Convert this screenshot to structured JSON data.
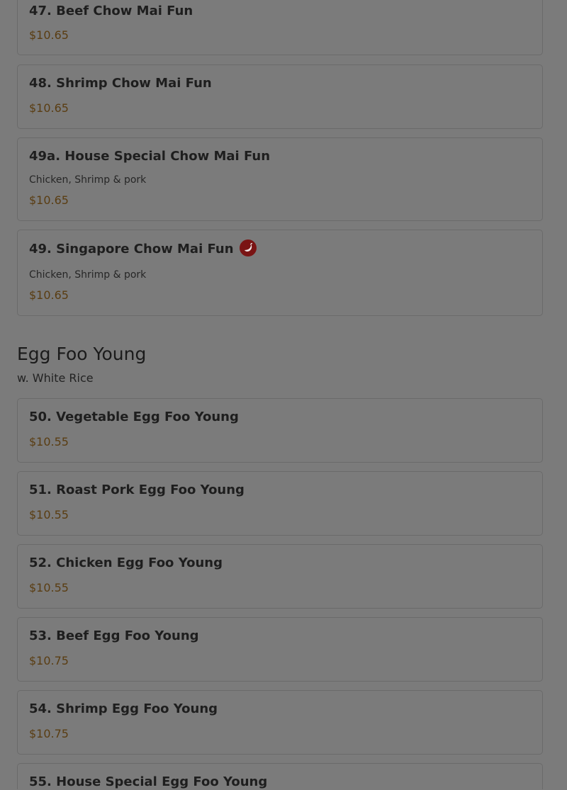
{
  "sections": [
    {
      "items": [
        {
          "name": "47. Beef Chow Mai Fun",
          "price": "$10.65"
        },
        {
          "name": "48. Shrimp Chow Mai Fun",
          "price": "$10.65"
        },
        {
          "name": "49a. House Special Chow Mai Fun",
          "description": "Chicken, Shrimp & pork",
          "price": "$10.65"
        },
        {
          "name": "49. Singapore Chow Mai Fun",
          "description": "Chicken, Shrimp & pork",
          "price": "$10.65",
          "icon": "spicy-pepper-icon"
        }
      ]
    },
    {
      "title": "Egg Foo Young",
      "subtitle": "w. White Rice",
      "items": [
        {
          "name": "50. Vegetable Egg Foo Young",
          "price": "$10.55"
        },
        {
          "name": "51. Roast Pork Egg Foo Young",
          "price": "$10.55"
        },
        {
          "name": "52. Chicken Egg Foo Young",
          "price": "$10.55"
        },
        {
          "name": "53. Beef Egg Foo Young",
          "price": "$10.75"
        },
        {
          "name": "54. Shrimp Egg Foo Young",
          "price": "$10.75"
        },
        {
          "name": "55. House Special Egg Foo Young"
        }
      ]
    }
  ],
  "colors": {
    "overlay_background": "#7b7b7b",
    "price": "#5a3d12",
    "spicy_icon": "#7a1414"
  }
}
